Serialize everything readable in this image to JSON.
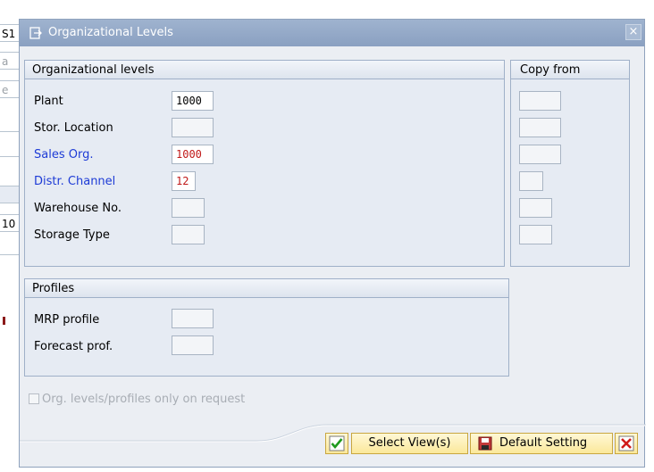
{
  "background": {
    "fragments": [
      "S1",
      "a",
      "e",
      "10"
    ]
  },
  "dialog": {
    "title": "Organizational Levels",
    "close_glyph": "×"
  },
  "org_group": {
    "header": "Organizational levels",
    "rows": [
      {
        "label": "Plant",
        "value": "1000",
        "color": "black"
      },
      {
        "label": "Stor. Location",
        "value": "",
        "color": "black"
      },
      {
        "label": "Sales Org.",
        "value": "1000",
        "color": "blue"
      },
      {
        "label": "Distr. Channel",
        "value": "12",
        "color": "blue"
      },
      {
        "label": "Warehouse No.",
        "value": "",
        "color": "black"
      },
      {
        "label": "Storage Type",
        "value": "",
        "color": "black"
      }
    ]
  },
  "copy_group": {
    "header": "Copy from"
  },
  "profiles_group": {
    "header": "Profiles",
    "rows": [
      {
        "label": "MRP profile",
        "value": ""
      },
      {
        "label": "Forecast prof.",
        "value": ""
      }
    ]
  },
  "checkbox": {
    "label": "Org. levels/profiles only on request",
    "checked": false
  },
  "buttons": {
    "select_views": "Select View(s)",
    "default_setting": "Default Setting"
  },
  "colors": {
    "title_bar": "#8aa0c1",
    "required_label": "#1d3bd6",
    "changed_value": "#c01818",
    "button_bg": "#fbe89a"
  }
}
